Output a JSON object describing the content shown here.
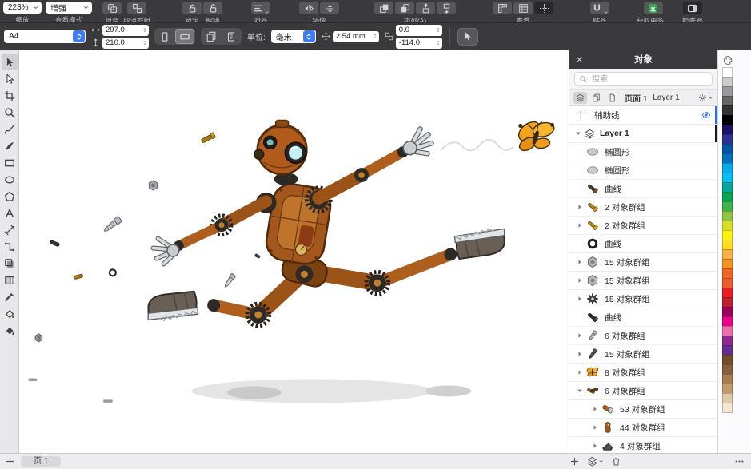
{
  "colors": {
    "accent": "#3d7bf7",
    "chrome": "#3a3a3c",
    "canvas": "#ffffff",
    "guides_layer_color": "#2f6be4",
    "layer1_color": "#1b1b1d",
    "get_more_green": "#36a852"
  },
  "toolbar": {
    "zoom": {
      "value": "223%",
      "label": "缩放"
    },
    "view_mode": {
      "value": "增强",
      "label": "查看模式"
    },
    "groups": [
      {
        "label": "组合",
        "buttons": [
          {
            "icon": "combine-icon"
          }
        ]
      },
      {
        "label": "取消群组",
        "buttons": [
          {
            "icon": "ungroup-icon"
          }
        ]
      },
      {
        "label": "锁定",
        "buttons": [
          {
            "icon": "lock-icon"
          }
        ]
      },
      {
        "label": "解锁",
        "buttons": [
          {
            "icon": "unlock-icon"
          }
        ]
      },
      {
        "label": "对齐",
        "buttons": [
          {
            "icon": "align-icon",
            "chevron": true
          }
        ]
      },
      {
        "label": "镜像",
        "buttons": [
          {
            "icon": "flip-horizontal-icon"
          },
          {
            "icon": "flip-vertical-icon"
          }
        ]
      },
      {
        "label": "排列(A)",
        "buttons": [
          {
            "icon": "order-to-front-icon"
          },
          {
            "icon": "order-to-back-icon"
          },
          {
            "icon": "order-forward-icon"
          },
          {
            "icon": "order-backward-icon"
          }
        ]
      },
      {
        "label": "查看",
        "buttons": [
          {
            "icon": "view-rulers-icon"
          },
          {
            "icon": "view-grid-icon"
          },
          {
            "icon": "view-guides-icon",
            "active": true
          }
        ]
      },
      {
        "label": "贴齐",
        "buttons": [
          {
            "icon": "snap-magnet-icon",
            "chevron": true
          }
        ]
      },
      {
        "label": "获取更多...",
        "buttons": [
          {
            "icon": "get-more-icon"
          }
        ]
      },
      {
        "label": "检查器",
        "buttons": [
          {
            "icon": "inspector-icon",
            "active": true
          }
        ]
      }
    ]
  },
  "property_bar": {
    "page_size": "A4",
    "page_width": "297.0",
    "page_height": "210.0",
    "units_label": "单位:",
    "units_value": "毫米",
    "nudge_value": "2.54 mm",
    "duplicate_x": "0.0",
    "duplicate_y": "-114.0"
  },
  "toolbox": {
    "tools": [
      {
        "name": "pick",
        "icon": "tool-pick",
        "active": true
      },
      {
        "name": "shape",
        "icon": "tool-shape"
      },
      {
        "name": "crop",
        "icon": "tool-crop"
      },
      {
        "name": "zoom",
        "icon": "tool-zoom"
      },
      {
        "name": "freehand",
        "icon": "tool-freehand"
      },
      {
        "name": "artistic-media",
        "icon": "tool-artistic-media"
      },
      {
        "name": "rectangle",
        "icon": "tool-rectangle"
      },
      {
        "name": "ellipse",
        "icon": "tool-ellipse"
      },
      {
        "name": "polygon",
        "icon": "tool-polygon"
      },
      {
        "name": "text",
        "icon": "tool-text"
      },
      {
        "name": "dimension",
        "icon": "tool-dimension"
      },
      {
        "name": "connector",
        "icon": "tool-connector"
      },
      {
        "name": "drop-shadow",
        "icon": "tool-drop-shadow"
      },
      {
        "name": "transparency",
        "icon": "tool-transparency"
      },
      {
        "name": "eyedropper",
        "icon": "tool-eyedropper"
      },
      {
        "name": "interactive-fill",
        "icon": "tool-interactive-fill"
      },
      {
        "name": "smart-fill",
        "icon": "tool-smart-fill"
      }
    ]
  },
  "objects_panel": {
    "title": "对象",
    "search_placeholder": "搜索",
    "breadcrumb": {
      "page": "页面 1",
      "layer": "Layer 1"
    },
    "guides_label": "辅助线",
    "layer_row": {
      "name": "Layer 1"
    },
    "rows": [
      {
        "label": "椭圆形",
        "icon": "thumb-ellipse",
        "caret": "none",
        "indent": 1
      },
      {
        "label": "椭圆形",
        "icon": "thumb-ellipse",
        "caret": "none",
        "indent": 1
      },
      {
        "label": "曲线",
        "icon": "thumb-bolt-dark",
        "caret": "none",
        "indent": 1
      },
      {
        "label": "2 对象群组",
        "icon": "thumb-bolt-gold",
        "caret": "right",
        "indent": 1
      },
      {
        "label": "2 对象群组",
        "icon": "thumb-bolt-gold",
        "caret": "right",
        "indent": 1
      },
      {
        "label": "曲线",
        "icon": "thumb-ring",
        "caret": "none",
        "indent": 1
      },
      {
        "label": "15 对象群组",
        "icon": "thumb-nut",
        "caret": "right",
        "indent": 1
      },
      {
        "label": "15 对象群组",
        "icon": "thumb-nut",
        "caret": "right",
        "indent": 1
      },
      {
        "label": "15 对象群组",
        "icon": "thumb-gear",
        "caret": "right",
        "indent": 1
      },
      {
        "label": "曲线",
        "icon": "thumb-bolt-black",
        "caret": "none",
        "indent": 1
      },
      {
        "label": "6 对象群组",
        "icon": "thumb-screw",
        "caret": "right",
        "indent": 1
      },
      {
        "label": "15 对象群组",
        "icon": "thumb-screw-dark",
        "caret": "right",
        "indent": 1
      },
      {
        "label": "8 对象群组",
        "icon": "thumb-butterfly",
        "caret": "right",
        "indent": 1
      },
      {
        "label": "6 对象群组",
        "icon": "thumb-parts",
        "caret": "down",
        "indent": 1
      },
      {
        "label": "53 对象群组",
        "icon": "thumb-leg",
        "caret": "right",
        "indent": 2
      },
      {
        "label": "44 对象群组",
        "icon": "thumb-robot",
        "caret": "right",
        "indent": 2
      },
      {
        "label": "4 对象群组",
        "icon": "thumb-boot",
        "caret": "right",
        "indent": 2
      }
    ]
  },
  "status_bar": {
    "page_tab": "页 1"
  },
  "palette": {
    "colors": [
      "#FFFFFF",
      "#CCCCCC",
      "#999999",
      "#666666",
      "#333333",
      "#000000",
      "#1B1464",
      "#2E3192",
      "#0054A6",
      "#0072BC",
      "#00AEEF",
      "#00C0F3",
      "#00A99D",
      "#00A651",
      "#39B54A",
      "#8DC63F",
      "#D7DF23",
      "#FFF200",
      "#FFDE17",
      "#FBB040",
      "#F7941D",
      "#F26522",
      "#F15A29",
      "#ED1C24",
      "#BE1E2D",
      "#9E005D",
      "#EC008C",
      "#F06EA9",
      "#92278F",
      "#662D91",
      "#754C29",
      "#8B5E3C",
      "#A97C50",
      "#C49A6C",
      "#E0C9A6",
      "#F5E6CE"
    ]
  }
}
